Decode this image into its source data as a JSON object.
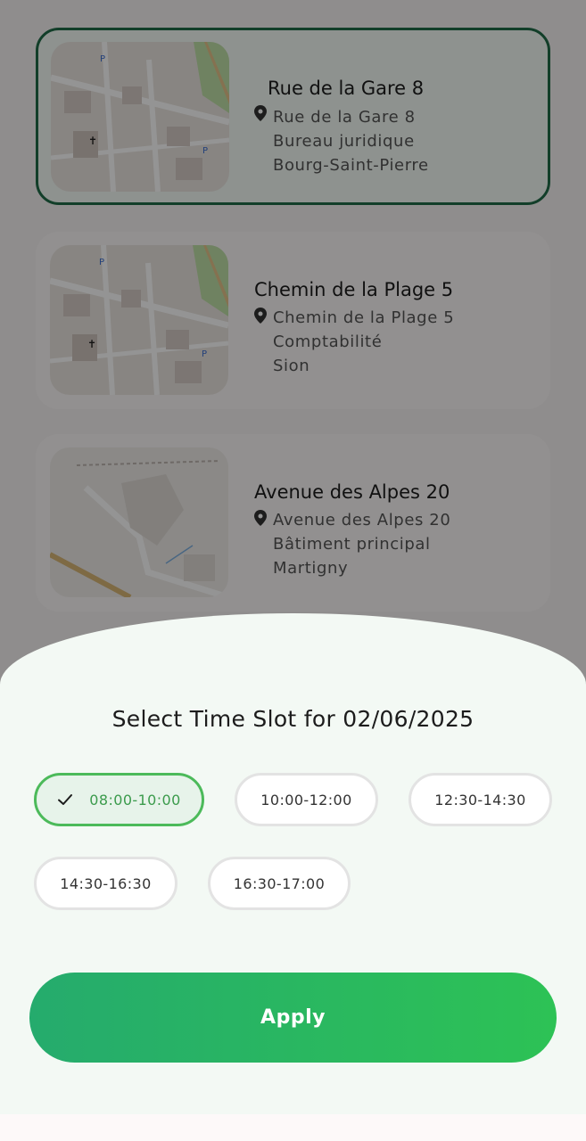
{
  "locations": [
    {
      "title": "Rue de la Gare 8",
      "street": "Rue de la Gare 8",
      "department": "Bureau juridique",
      "city": "Bourg-Saint-Pierre",
      "selected": true
    },
    {
      "title": "Chemin de la Plage 5",
      "street": "Chemin de la Plage 5",
      "department": "Comptabilité",
      "city": "Sion",
      "selected": false
    },
    {
      "title": "Avenue des Alpes 20",
      "street": "Avenue des Alpes 20",
      "department": "Bâtiment principal",
      "city": "Martigny",
      "selected": false
    }
  ],
  "sheet": {
    "title": "Select Time Slot for 02/06/2025",
    "slots": [
      {
        "label": "08:00-10:00",
        "selected": true
      },
      {
        "label": "10:00-12:00",
        "selected": false
      },
      {
        "label": "12:30-14:30",
        "selected": false
      },
      {
        "label": "14:30-16:30",
        "selected": false
      },
      {
        "label": "16:30-17:00",
        "selected": false
      }
    ],
    "apply_label": "Apply"
  },
  "icons": {
    "location": "map-pin-icon",
    "selected_slot": "check-icon"
  },
  "colors": {
    "accent_green": "#2dc255",
    "selected_border": "#1f6b47",
    "slot_active_text": "#3b9b4c"
  }
}
